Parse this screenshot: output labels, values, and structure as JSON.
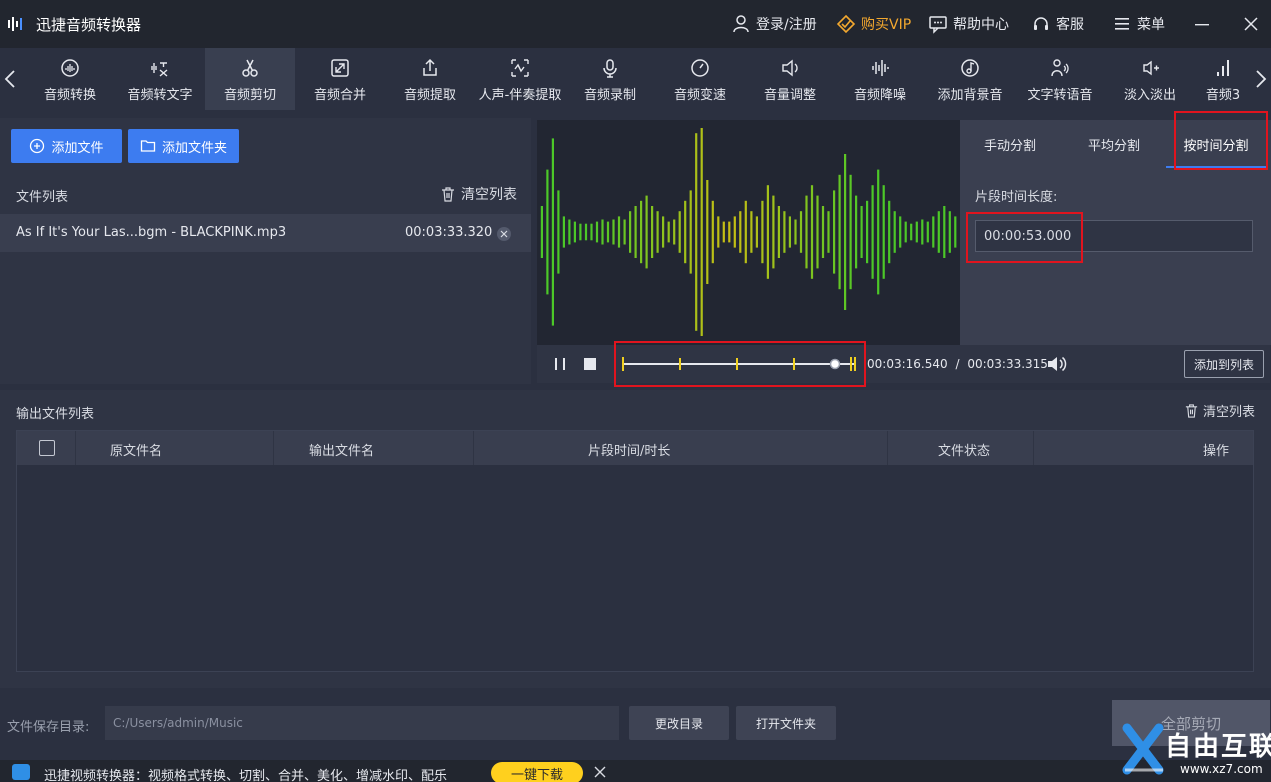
{
  "app": {
    "title": "迅捷音频转换器"
  },
  "titlebar": {
    "login": "登录/注册",
    "vip": "购买VIP",
    "help": "帮助中心",
    "service": "客服",
    "menu": "菜单",
    "vip_color": "#f3a82f"
  },
  "tools": [
    {
      "label": "音频转换",
      "icon": "audio-convert-icon"
    },
    {
      "label": "音频转文字",
      "icon": "audio-to-text-icon"
    },
    {
      "label": "音频剪切",
      "icon": "scissors-icon"
    },
    {
      "label": "音频合并",
      "icon": "merge-icon"
    },
    {
      "label": "音频提取",
      "icon": "extract-icon"
    },
    {
      "label": "人声-伴奏提取",
      "icon": "vocal-extract-icon"
    },
    {
      "label": "音频录制",
      "icon": "microphone-icon"
    },
    {
      "label": "音频变速",
      "icon": "speed-icon"
    },
    {
      "label": "音量调整",
      "icon": "volume-adjust-icon"
    },
    {
      "label": "音频降噪",
      "icon": "denoise-icon"
    },
    {
      "label": "添加背景音",
      "icon": "music-note-icon"
    },
    {
      "label": "文字转语音",
      "icon": "text-to-speech-icon"
    },
    {
      "label": "淡入淡出",
      "icon": "fade-icon"
    },
    {
      "label": "音频3",
      "icon": "audio-bars-icon"
    }
  ],
  "active_tool": "音频剪切",
  "file_panel": {
    "add_file": "添加文件",
    "add_folder": "添加文件夹",
    "list_title": "文件列表",
    "clear_list": "清空列表",
    "files": [
      {
        "name": "As If It's Your Las...bgm - BLACKPINK.mp3",
        "duration": "00:03:33.320"
      }
    ]
  },
  "player": {
    "current_time": "00:03:16.540",
    "separator": "/",
    "total_time": "00:03:33.315",
    "add_to_list": "添加到列表",
    "progress": 0.92
  },
  "split": {
    "tabs": [
      "手动分割",
      "平均分割",
      "按时间分割"
    ],
    "active_tab": "按时间分割",
    "segment_label": "片段时间长度:",
    "segment_value": "00:00:53.000"
  },
  "output": {
    "title": "输出文件列表",
    "clear": "清空列表",
    "columns": [
      "原文件名",
      "输出文件名",
      "片段时间/时长",
      "文件状态",
      "操作"
    ]
  },
  "bottom": {
    "save_label": "文件保存目录:",
    "save_path": "C:/Users/admin/Music",
    "change_dir": "更改目录",
    "open_folder": "打开文件夹",
    "cut_all": "全部剪切"
  },
  "ad": {
    "text": "迅捷视频转换器：视频格式转换、切割、合并、美化、增减水印、配乐",
    "download": "一键下载"
  },
  "watermark": {
    "text": "自由互联",
    "url": "www.xz7.com"
  },
  "waveform": {
    "amplitudes": [
      0.25,
      0.6,
      0.9,
      0.4,
      0.15,
      0.12,
      0.1,
      0.08,
      0.08,
      0.08,
      0.1,
      0.12,
      0.1,
      0.12,
      0.15,
      0.12,
      0.2,
      0.25,
      0.3,
      0.35,
      0.25,
      0.2,
      0.15,
      0.1,
      0.12,
      0.2,
      0.3,
      0.4,
      0.95,
      1.0,
      0.5,
      0.3,
      0.15,
      0.1,
      0.1,
      0.15,
      0.2,
      0.3,
      0.2,
      0.15,
      0.3,
      0.45,
      0.35,
      0.25,
      0.2,
      0.15,
      0.12,
      0.2,
      0.35,
      0.45,
      0.35,
      0.25,
      0.2,
      0.4,
      0.55,
      0.75,
      0.55,
      0.35,
      0.25,
      0.3,
      0.45,
      0.6,
      0.45,
      0.3,
      0.2,
      0.15,
      0.1,
      0.08,
      0.1,
      0.12,
      0.1,
      0.15,
      0.2,
      0.25,
      0.2,
      0.15
    ]
  }
}
